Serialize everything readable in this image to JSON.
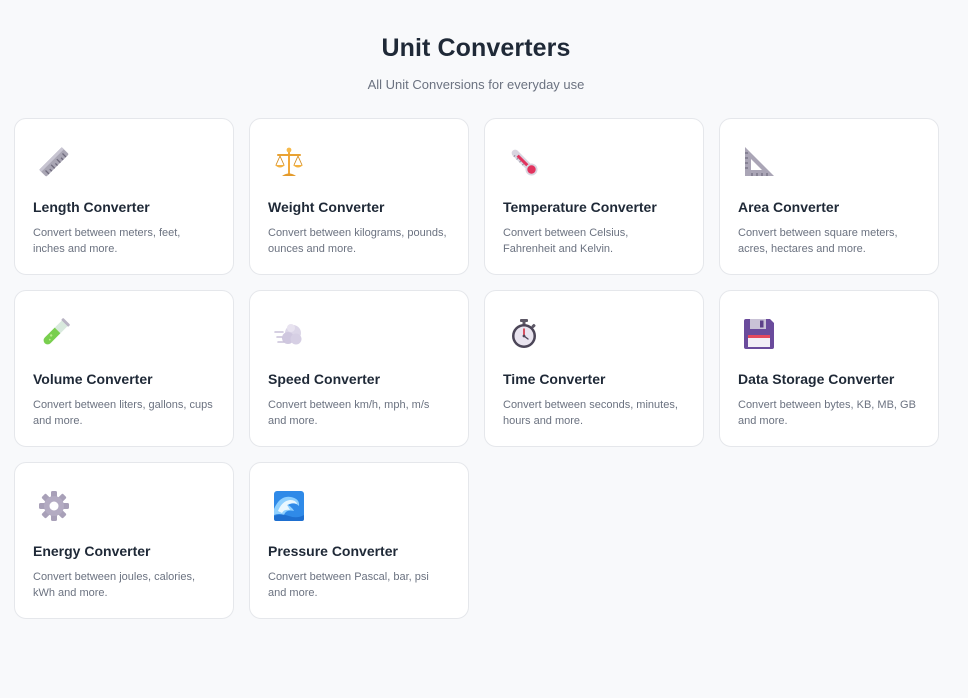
{
  "header": {
    "title": "Unit Converters",
    "subtitle": "All Unit Conversions for everyday use"
  },
  "converters": [
    {
      "title": "Length Converter",
      "description": "Convert between meters, feet, inches and more.",
      "icon": "ruler-icon"
    },
    {
      "title": "Weight Converter",
      "description": "Convert between kilograms, pounds, ounces and more.",
      "icon": "balance-scale-icon"
    },
    {
      "title": "Temperature Converter",
      "description": "Convert between Celsius, Fahrenheit and Kelvin.",
      "icon": "thermometer-icon"
    },
    {
      "title": "Area Converter",
      "description": "Convert between square meters, acres, hectares and more.",
      "icon": "triangle-ruler-icon"
    },
    {
      "title": "Volume Converter",
      "description": "Convert between liters, gallons, cups and more.",
      "icon": "test-tube-icon"
    },
    {
      "title": "Speed Converter",
      "description": "Convert between km/h, mph, m/s and more.",
      "icon": "dash-cloud-icon"
    },
    {
      "title": "Time Converter",
      "description": "Convert between seconds, minutes, hours and more.",
      "icon": "stopwatch-icon"
    },
    {
      "title": "Data Storage Converter",
      "description": "Convert between bytes, KB, MB, GB and more.",
      "icon": "floppy-disk-icon"
    },
    {
      "title": "Energy Converter",
      "description": "Convert between joules, calories, kWh and more.",
      "icon": "gear-icon"
    },
    {
      "title": "Pressure Converter",
      "description": "Convert between Pascal, bar, psi and more.",
      "icon": "water-wave-icon"
    }
  ]
}
